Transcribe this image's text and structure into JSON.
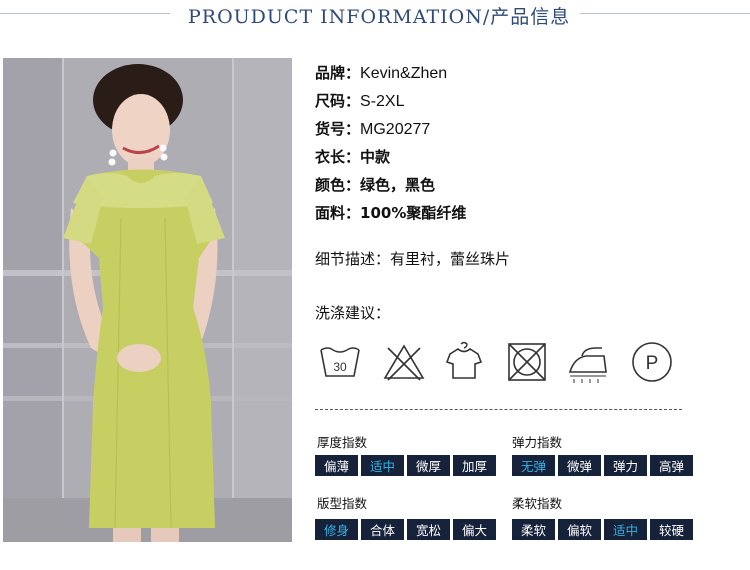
{
  "header": {
    "title": "PROUDUCT INFORMATION/产品信息"
  },
  "photo": {
    "subject": "model-dress-photo",
    "dress_color": "#c7cf63"
  },
  "specs": [
    {
      "key": "品牌：",
      "value": "Kevin&Zhen"
    },
    {
      "key": "尺码：",
      "value": "S-2XL"
    },
    {
      "key": "货号：",
      "value": "MG20277"
    },
    {
      "key": "衣长：",
      "value": "中款"
    },
    {
      "key": "颜色：",
      "value": "绿色，黑色"
    },
    {
      "key": "面料：",
      "value": "100%聚酯纤维"
    }
  ],
  "detail": {
    "label": "细节描述：",
    "value": "有里衬，蕾丝珠片"
  },
  "wash": {
    "title": "洗涤建议：",
    "icons": [
      "wash-30-icon",
      "no-bleach-icon",
      "hang-dry-icon",
      "no-tumble-dry-icon",
      "iron-icon",
      "dry-clean-p-icon"
    ],
    "wash_temp": "30",
    "dry_clean_letter": "P"
  },
  "indices": [
    {
      "title": "厚度指数",
      "options": [
        "偏薄",
        "适中",
        "微厚",
        "加厚"
      ],
      "selected": 1
    },
    {
      "title": "弹力指数",
      "options": [
        "无弹",
        "微弹",
        "弹力",
        "高弹"
      ],
      "selected": 0
    },
    {
      "title": "版型指数",
      "options": [
        "修身",
        "合体",
        "宽松",
        "偏大"
      ],
      "selected": 0
    },
    {
      "title": "柔软指数",
      "options": [
        "柔软",
        "偏软",
        "适中",
        "较硬"
      ],
      "selected": 2
    }
  ],
  "colors": {
    "chip_bg": "#16213a",
    "chip_text": "#ffffff",
    "chip_selected_text": "#35b3e6",
    "title": "#2e4a7a"
  }
}
